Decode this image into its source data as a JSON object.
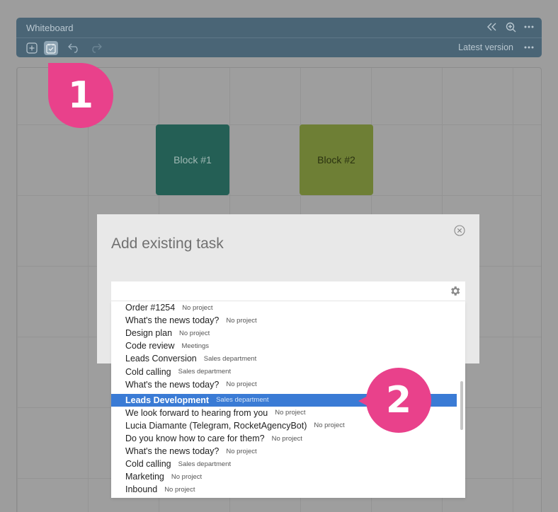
{
  "window": {
    "title": "Whiteboard",
    "version_label": "Latest version"
  },
  "blocks": [
    {
      "label": "Block #1",
      "color": "#245f55"
    },
    {
      "label": "Block #2",
      "color": "#6e7f35"
    }
  ],
  "markers": [
    "1",
    "2"
  ],
  "modal": {
    "title": "Add existing task",
    "search_value": ""
  },
  "tasks": [
    {
      "name": "Order #1254",
      "project": "No project"
    },
    {
      "name": "What's the news today?",
      "project": "No project"
    },
    {
      "name": "Design plan",
      "project": "No project"
    },
    {
      "name": "Code review",
      "project": "Meetings"
    },
    {
      "name": "Leads Conversion",
      "project": "Sales department"
    },
    {
      "name": "Cold calling",
      "project": "Sales department"
    },
    {
      "name": "What's the news today?",
      "project": "No project"
    },
    {
      "name": "Leads Development",
      "project": "Sales department",
      "selected": true
    },
    {
      "name": "We look forward to hearing from you",
      "project": "No project"
    },
    {
      "name": "Lucia Diamante (Telegram, RocketAgencyBot)",
      "project": "No project"
    },
    {
      "name": "Do you know how to care for them?",
      "project": "No project"
    },
    {
      "name": "What's the news today?",
      "project": "No project"
    },
    {
      "name": "Cold calling",
      "project": "Sales department"
    },
    {
      "name": "Marketing",
      "project": "No project"
    },
    {
      "name": "Inbound",
      "project": "No project"
    }
  ],
  "colors": {
    "accent_marker": "#e9418b",
    "selection": "#3a7bd5",
    "header": "#4a6576"
  },
  "icons": [
    "collapse-icon",
    "zoom-icon",
    "more-icon",
    "add-icon",
    "task-icon",
    "undo-icon",
    "redo-icon",
    "close-icon",
    "settings-icon"
  ]
}
